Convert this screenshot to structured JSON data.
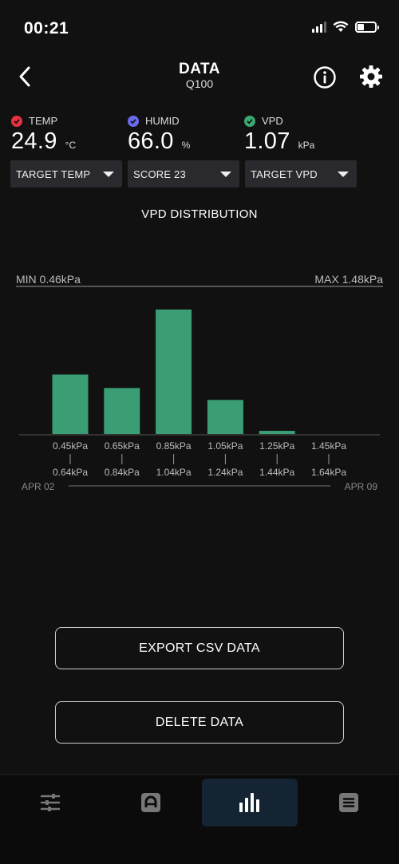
{
  "status": {
    "time": "00:21"
  },
  "header": {
    "title": "DATA",
    "subtitle": "Q100"
  },
  "readings": [
    {
      "label": "TEMP",
      "value": "24.9",
      "unit": "°C",
      "color": "#e8323f"
    },
    {
      "label": "HUMID",
      "value": "66.0",
      "unit": "%",
      "color": "#6b6bf0"
    },
    {
      "label": "VPD",
      "value": "1.07",
      "unit": "kPa",
      "color": "#3aa872"
    }
  ],
  "dropdowns": [
    {
      "label": "TARGET TEMP"
    },
    {
      "label": "SCORE 23"
    },
    {
      "label": "TARGET VPD"
    }
  ],
  "chart": {
    "title": "VPD DISTRIBUTION",
    "min_label": "MIN 0.46kPa",
    "max_label": "MAX 1.48kPa",
    "start_date": "APR 02",
    "end_date": "APR 09",
    "bar_color": "#3a9d74"
  },
  "chart_data": {
    "type": "bar",
    "categories": [
      {
        "from": "0.45kPa",
        "to": "0.64kPa"
      },
      {
        "from": "0.65kPa",
        "to": "0.84kPa"
      },
      {
        "from": "0.85kPa",
        "to": "1.04kPa"
      },
      {
        "from": "1.05kPa",
        "to": "1.24kPa"
      },
      {
        "from": "1.25kPa",
        "to": "1.44kPa"
      },
      {
        "from": "1.45kPa",
        "to": "1.64kPa"
      }
    ],
    "values": [
      75,
      58,
      157,
      43,
      4,
      0
    ],
    "ylim": [
      0,
      157
    ]
  },
  "actions": {
    "export_label": "EXPORT CSV DATA",
    "delete_label": "DELETE DATA"
  },
  "nav": {
    "items": [
      "sliders-icon",
      "dashboard-icon",
      "bar-chart-icon",
      "list-icon"
    ],
    "active_index": 2
  }
}
